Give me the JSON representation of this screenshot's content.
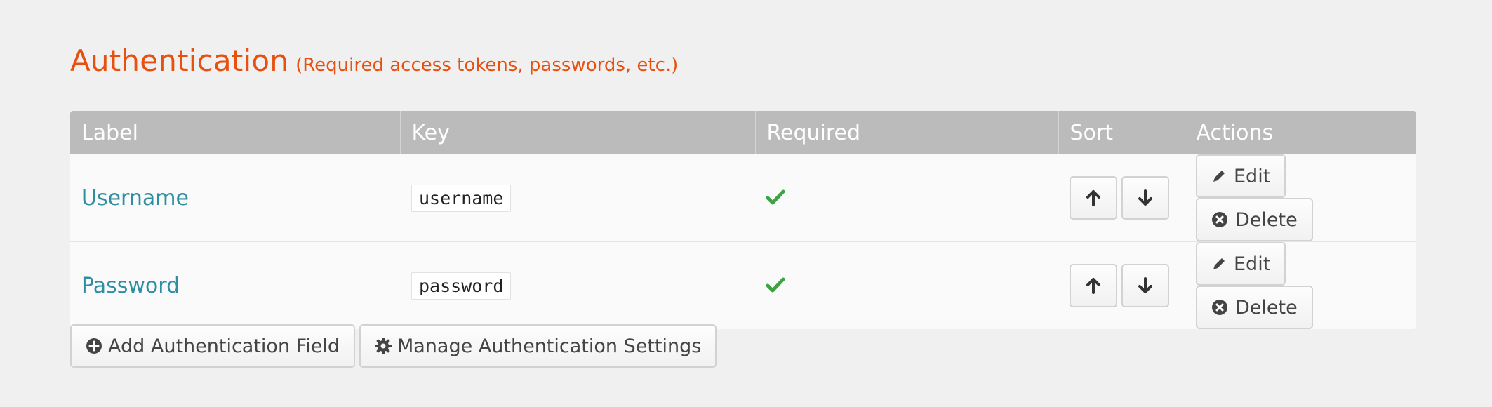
{
  "section": {
    "title": "Authentication",
    "subtitle": "(Required access tokens, passwords, etc.)"
  },
  "table": {
    "headers": {
      "label": "Label",
      "key": "Key",
      "required": "Required",
      "sort": "Sort",
      "actions": "Actions"
    },
    "rows": [
      {
        "label": "Username",
        "key": "username",
        "required": true
      },
      {
        "label": "Password",
        "key": "password",
        "required": true
      }
    ],
    "edit_label": "Edit",
    "delete_label": "Delete"
  },
  "footer": {
    "add_label": "Add Authentication Field",
    "manage_label": "Manage Authentication Settings"
  },
  "colors": {
    "accent": "#e8500f",
    "link": "#2e8fa3",
    "check": "#3ea346",
    "header_bg": "#bbbbbb"
  },
  "icons": {
    "required": "check-icon",
    "sort_up": "arrow-up-icon",
    "sort_down": "arrow-down-icon",
    "edit": "pencil-icon",
    "delete": "circle-x-icon",
    "add": "circle-plus-icon",
    "manage": "gear-icon"
  }
}
